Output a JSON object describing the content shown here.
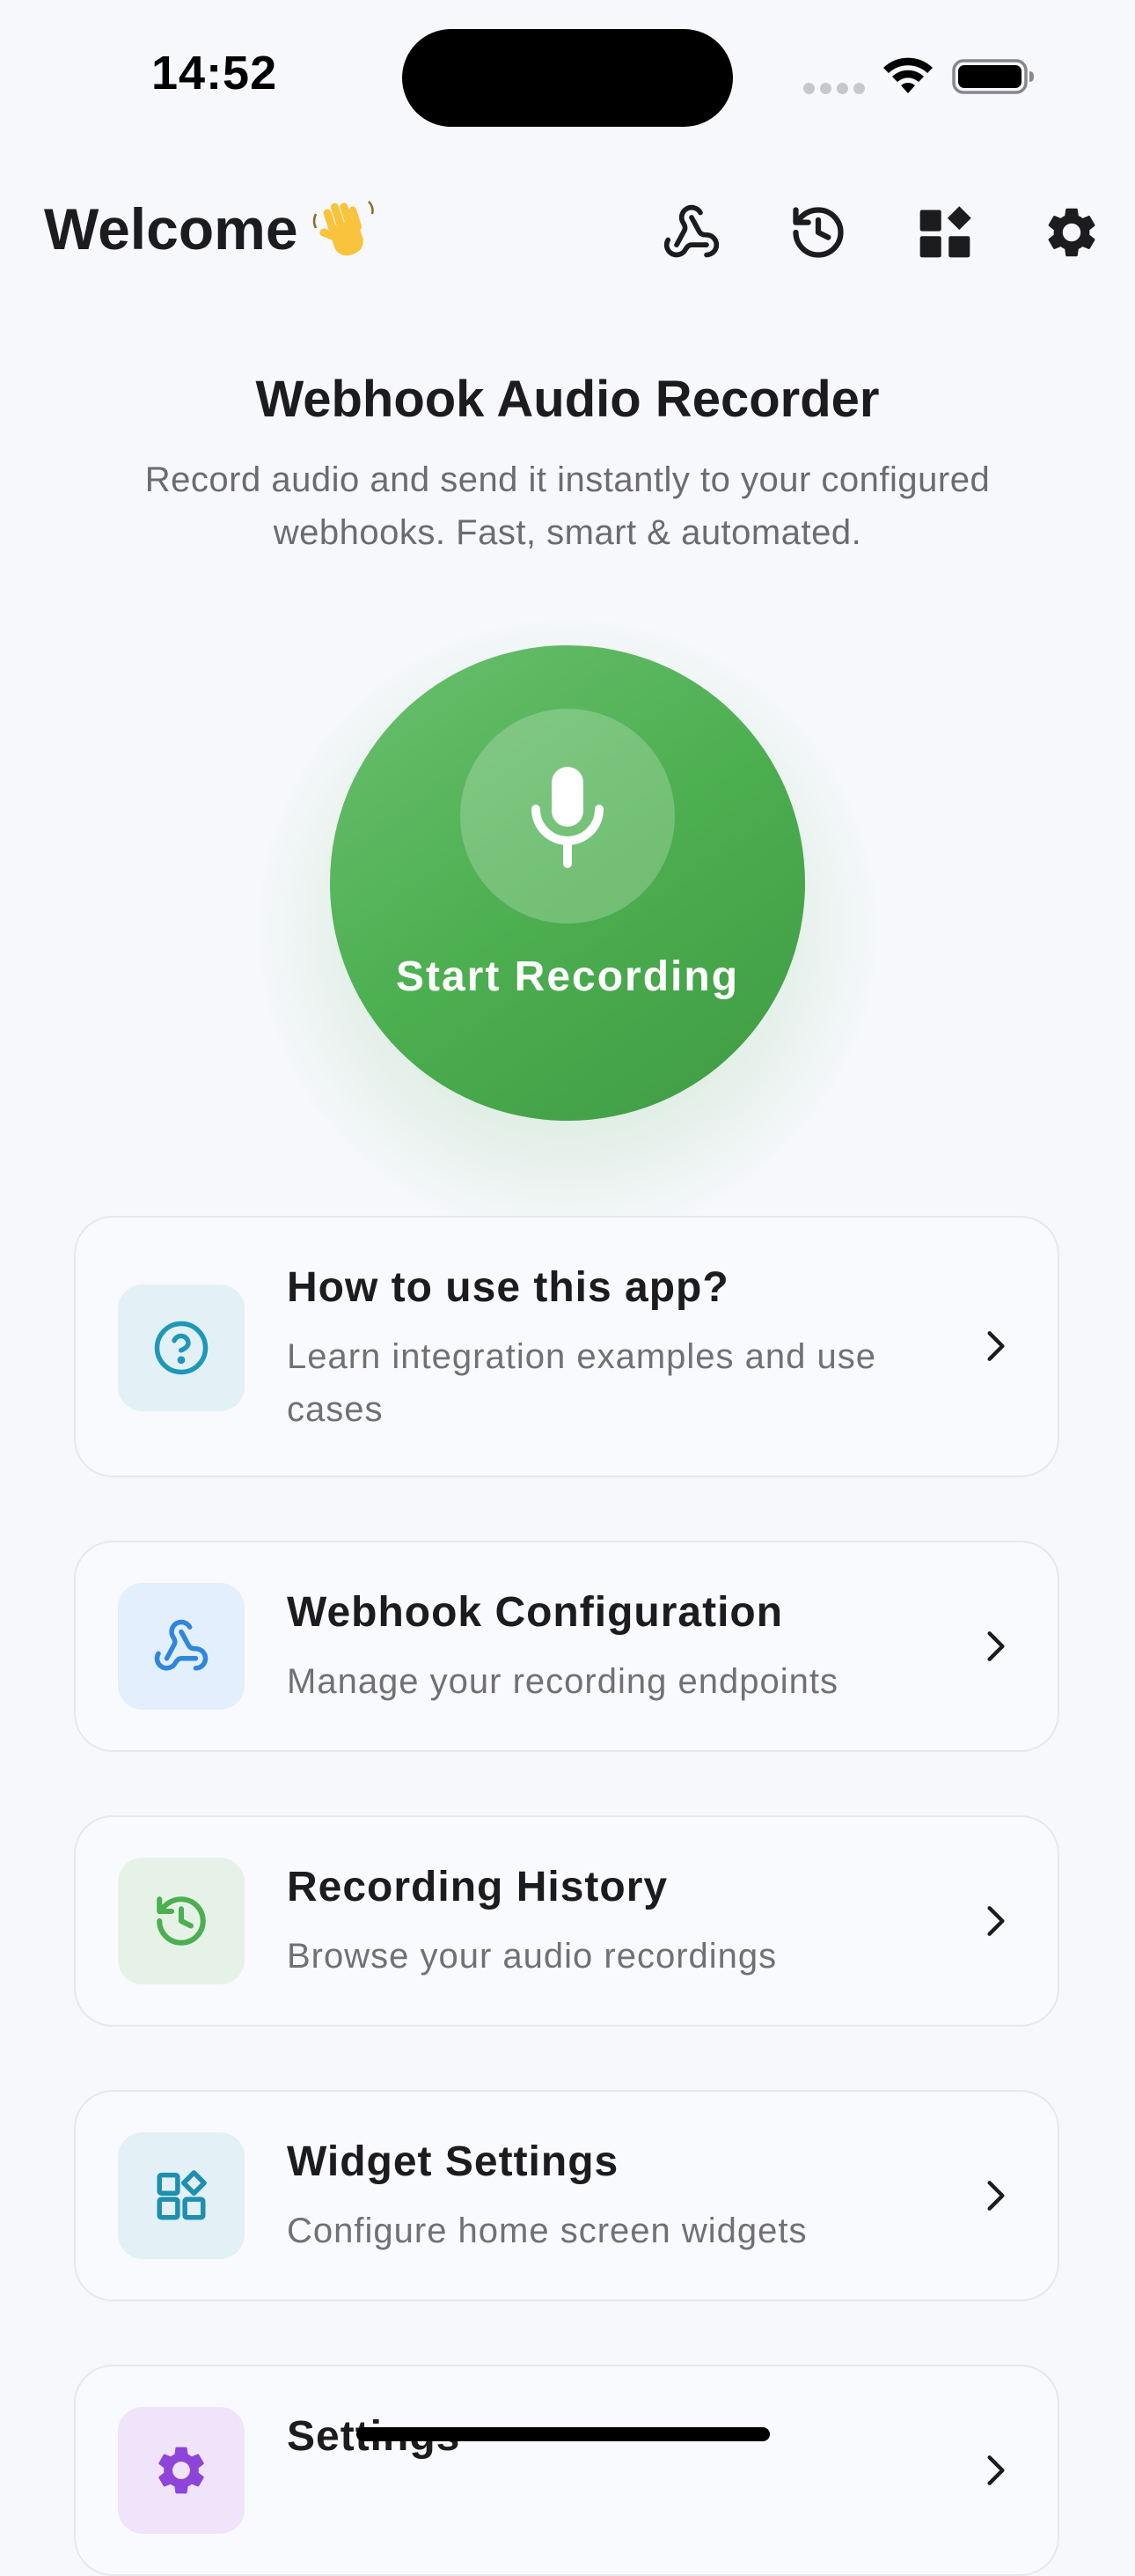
{
  "status_bar": {
    "time": "14:52"
  },
  "header": {
    "title": "Welcome",
    "icons": [
      "webhook-icon",
      "history-icon",
      "widgets-icon",
      "settings-gear-icon"
    ]
  },
  "intro": {
    "title": "Webhook Audio Recorder",
    "subtitle": "Record audio and send it instantly to your configured webhooks. Fast, smart & automated."
  },
  "record_button": {
    "label": "Start Recording",
    "color": "#4caf50"
  },
  "menu": [
    {
      "title": "How to use this app?",
      "description": "Learn integration examples and use cases",
      "icon": "help-circle-icon",
      "accent": "#1e98b8"
    },
    {
      "title": "Webhook Configuration",
      "description": "Manage your recording endpoints",
      "icon": "webhook-icon",
      "accent": "#2f86dd"
    },
    {
      "title": "Recording History",
      "description": "Browse your audio recordings",
      "icon": "history-icon",
      "accent": "#4caf50"
    },
    {
      "title": "Widget Settings",
      "description": "Configure home screen widgets",
      "icon": "widgets-icon",
      "accent": "#1e8fb0"
    },
    {
      "title": "Settings",
      "description": "",
      "icon": "settings-gear-icon",
      "accent": "#8e44d8"
    }
  ]
}
